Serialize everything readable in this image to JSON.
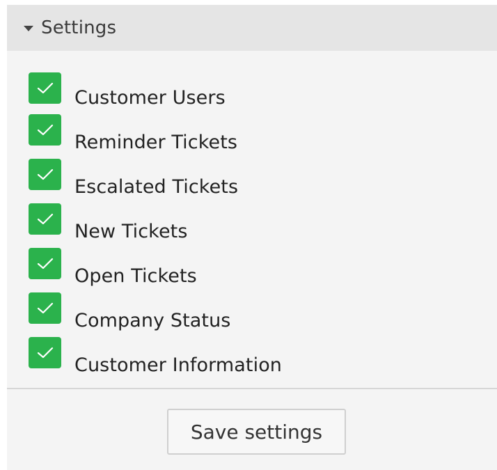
{
  "panel": {
    "title": "Settings",
    "toggle_icon": "caret-down-icon"
  },
  "options": [
    {
      "label": "Customer Users",
      "checked": true
    },
    {
      "label": "Reminder Tickets",
      "checked": true
    },
    {
      "label": "Escalated Tickets",
      "checked": true
    },
    {
      "label": "New Tickets",
      "checked": true
    },
    {
      "label": "Open Tickets",
      "checked": true
    },
    {
      "label": "Company Status",
      "checked": true
    },
    {
      "label": "Customer Information",
      "checked": true
    }
  ],
  "actions": {
    "save_label": "Save settings"
  },
  "colors": {
    "checkbox_checked": "#2bb24c",
    "header_bg": "#e5e5e5",
    "panel_bg": "#f4f4f4"
  }
}
